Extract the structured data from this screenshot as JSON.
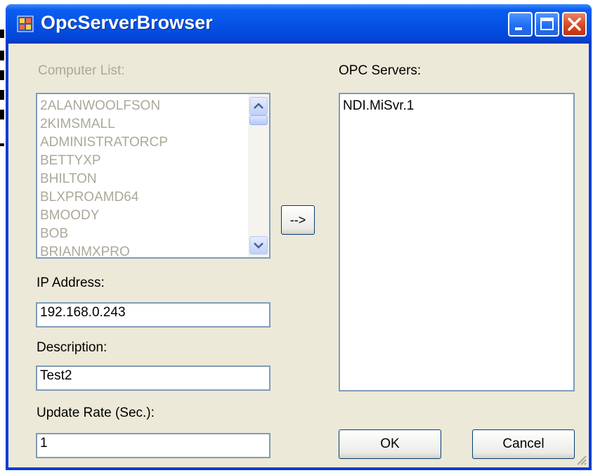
{
  "window": {
    "title": "OpcServerBrowser"
  },
  "titlebar_buttons": {
    "minimize": "minimize-icon",
    "maximize": "maximize-icon",
    "close": "close-icon"
  },
  "computer_list": {
    "label": "Computer List:",
    "items": [
      "2ALANWOOLFSON",
      "2KIMSMALL",
      "ADMINISTRATORCP",
      "BETTYXP",
      "BHILTON",
      "BLXPROAMD64",
      "BMOODY",
      "BOB",
      "BRIANMXPRO"
    ]
  },
  "arrow_button_label": "-->",
  "opc_servers": {
    "label": "OPC Servers:",
    "items": [
      "NDI.MiSvr.1"
    ]
  },
  "ip_address": {
    "label": "IP Address:",
    "value": "192.168.0.243"
  },
  "description": {
    "label": "Description:",
    "value": "Test2"
  },
  "update_rate": {
    "label": "Update Rate (Sec.):",
    "value": "1"
  },
  "buttons": {
    "ok": "OK",
    "cancel": "Cancel"
  },
  "colors": {
    "titlebar": "#0553e6",
    "client_bg": "#ece9d8",
    "close_button": "#d4441f",
    "disabled_text": "#aca899",
    "field_border": "#7f9db9"
  }
}
